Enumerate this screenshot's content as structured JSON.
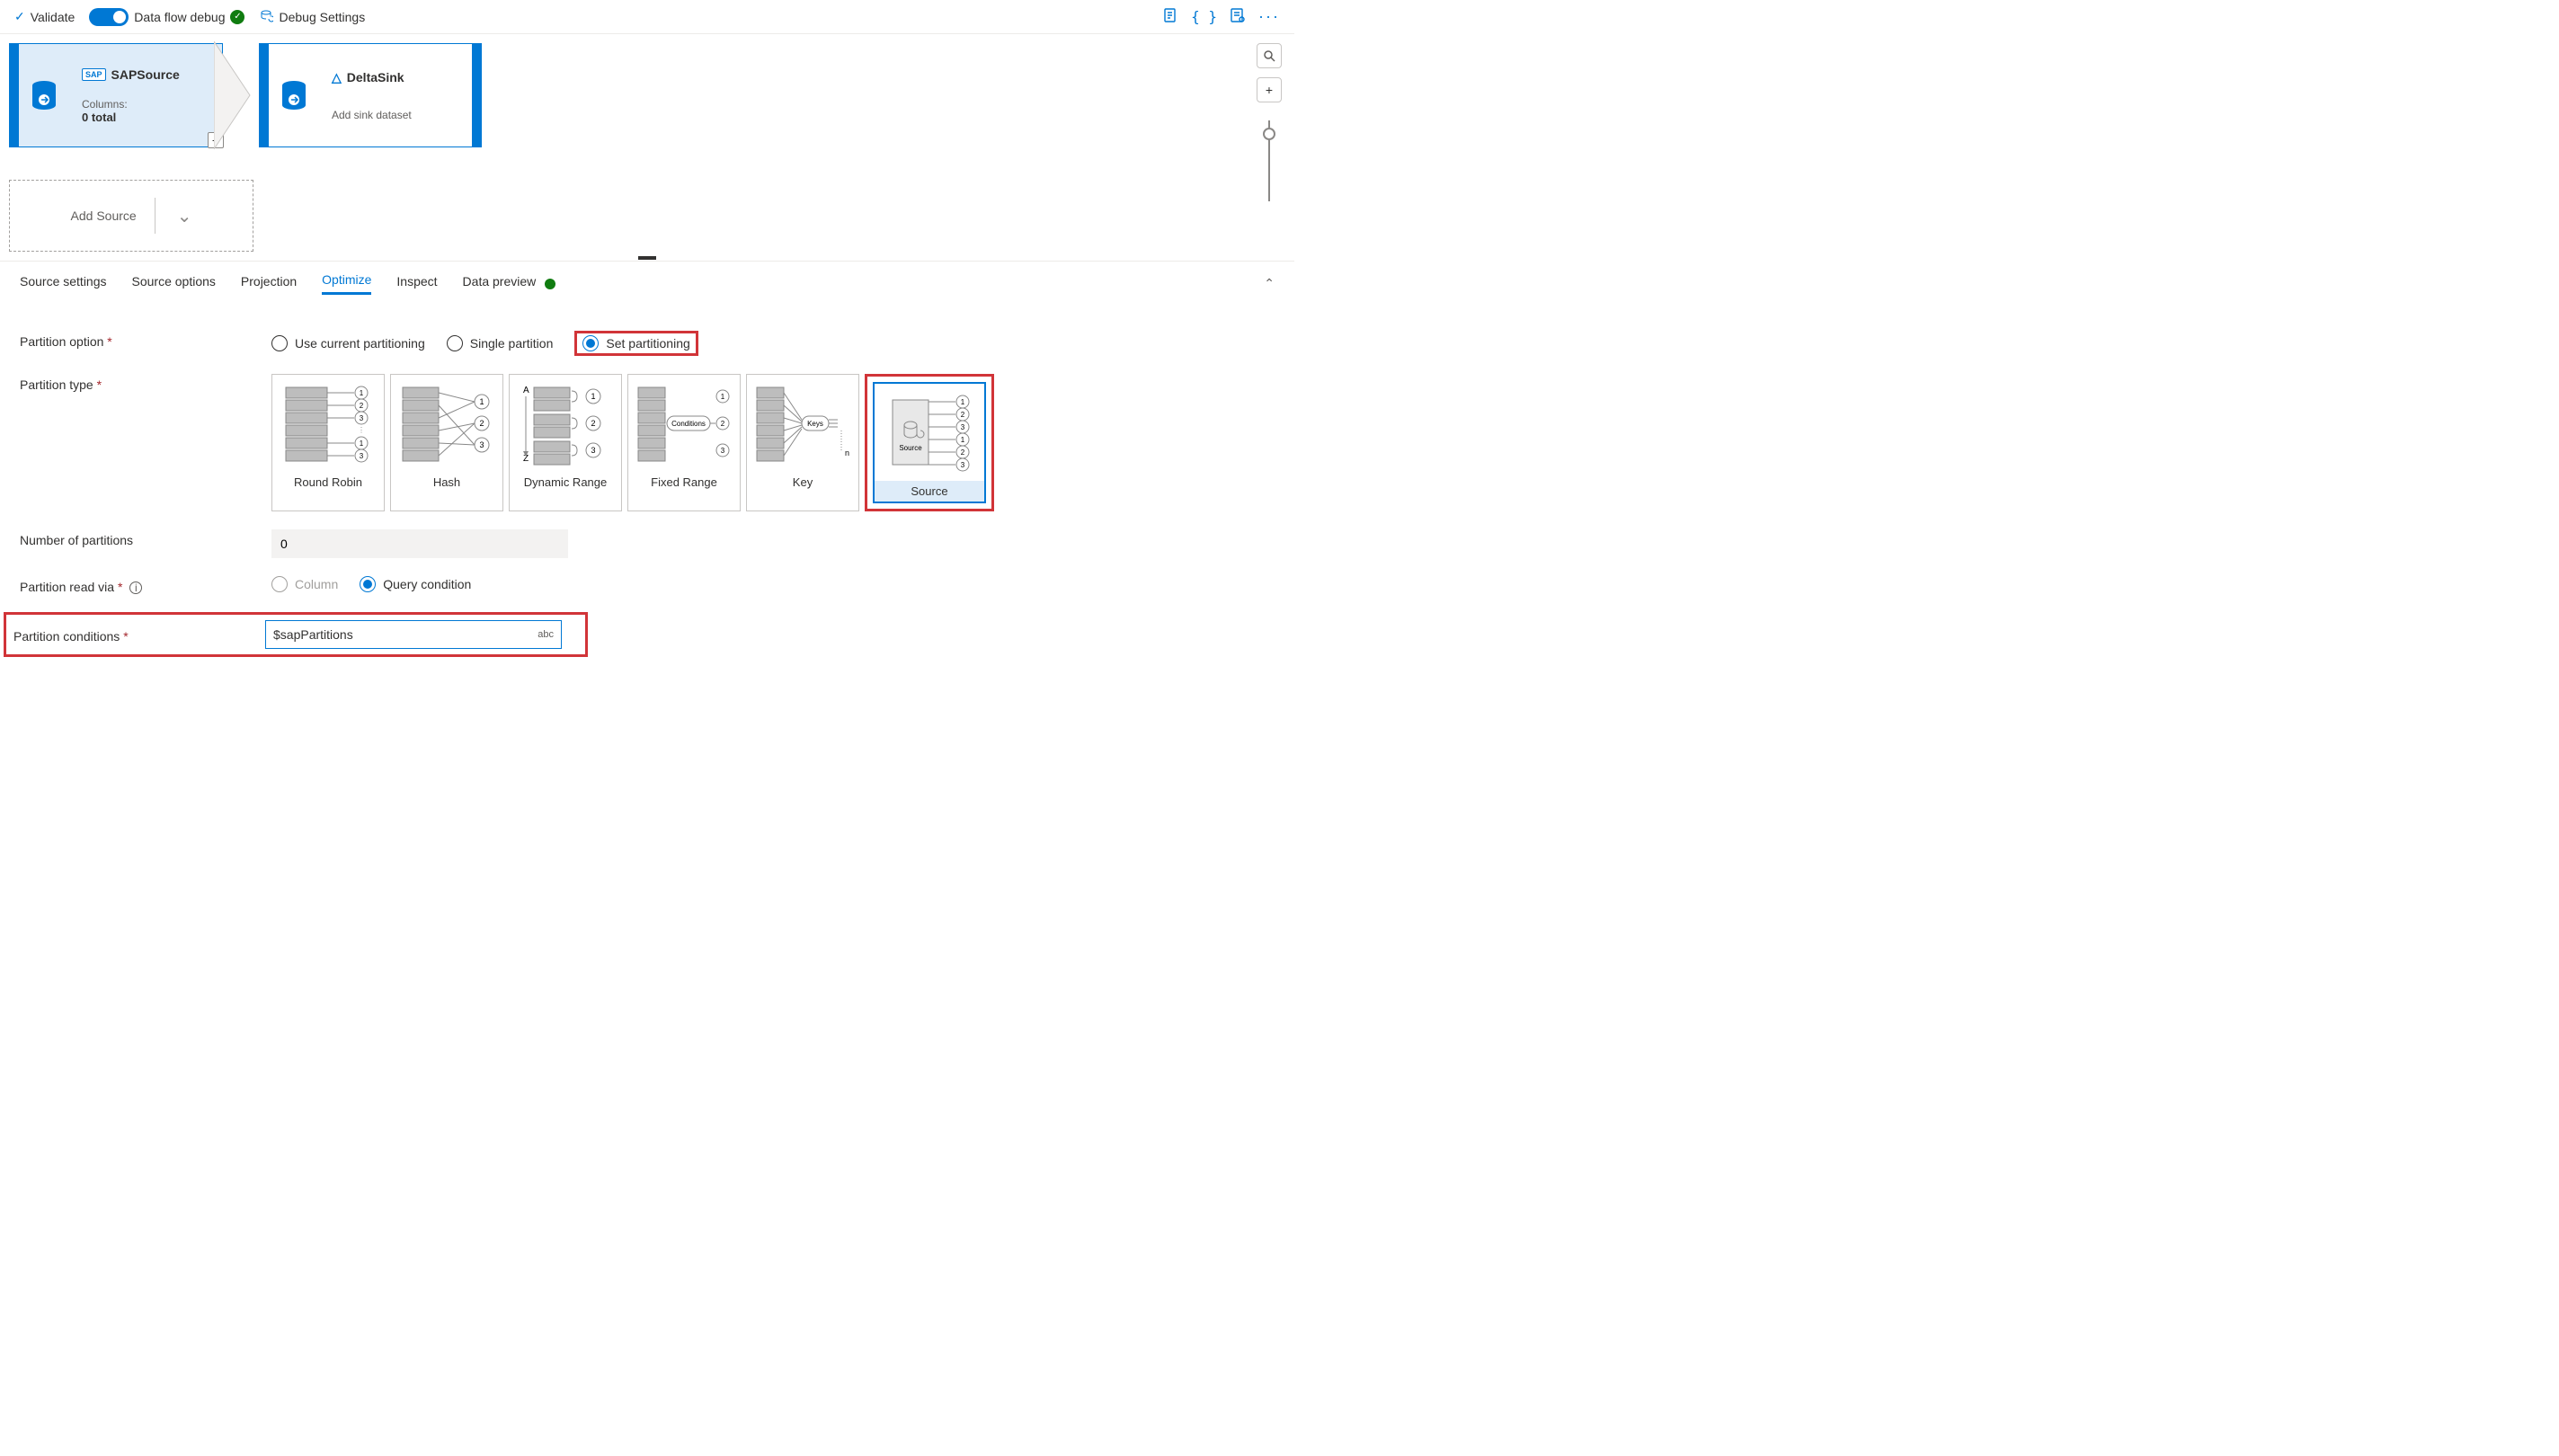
{
  "toolbar": {
    "validate": "Validate",
    "debug_label": "Data flow debug",
    "debug_settings": "Debug Settings"
  },
  "flow": {
    "source": {
      "title": "SAPSource",
      "sub1": "Columns:",
      "sub2": "0 total"
    },
    "sink": {
      "title": "DeltaSink",
      "sub": "Add sink dataset"
    },
    "add_source": "Add Source"
  },
  "tabs": {
    "t0": "Source settings",
    "t1": "Source options",
    "t2": "Projection",
    "t3": "Optimize",
    "t4": "Inspect",
    "t5": "Data preview"
  },
  "labels": {
    "partition_option": "Partition option",
    "partition_type": "Partition type",
    "num_partitions": "Number of partitions",
    "read_via": "Partition read via",
    "conditions": "Partition conditions"
  },
  "partition_options": {
    "o0": "Use current partitioning",
    "o1": "Single partition",
    "o2": "Set partitioning"
  },
  "partition_types": {
    "p0": "Round Robin",
    "p1": "Hash",
    "p2": "Dynamic Range",
    "p3": "Fixed Range",
    "p4": "Key",
    "p5": "Source",
    "fixed_badge": "Conditions",
    "key_badge": "Keys",
    "src_badge": "Source"
  },
  "values": {
    "num_partitions": "0",
    "read_column": "Column",
    "read_query": "Query condition",
    "conditions": "$sapPartitions",
    "abc": "abc"
  }
}
